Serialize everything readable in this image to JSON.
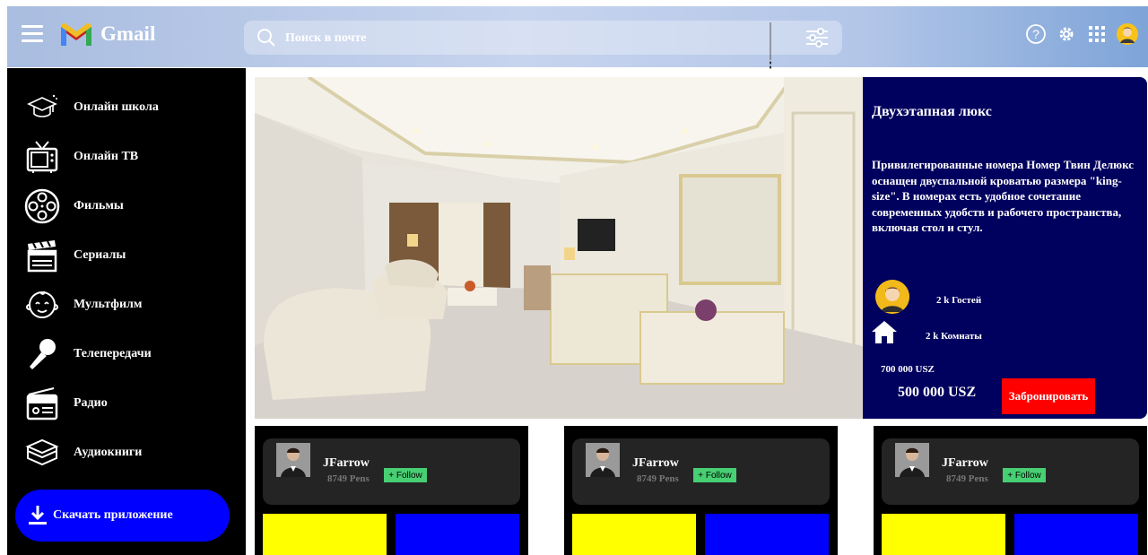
{
  "header": {
    "app_name": "Gmail",
    "search_placeholder": "Поиск в почте",
    "icons": [
      "menu-icon",
      "gmail-logo",
      "search-icon",
      "filter-options-icon",
      "help-icon",
      "settings-icon",
      "apps-grid-icon",
      "account-avatar"
    ]
  },
  "sidebar": {
    "items": [
      {
        "label": "Онлайн школа",
        "icon": "graduation-cap-icon"
      },
      {
        "label": "Онлайн ТВ",
        "icon": "tv-icon"
      },
      {
        "label": "Фильмы",
        "icon": "film-reel-icon"
      },
      {
        "label": "Сериалы",
        "icon": "clapperboard-icon"
      },
      {
        "label": "Мультфилм",
        "icon": "baby-face-icon"
      },
      {
        "label": "Телепередачи",
        "icon": "microphone-icon"
      },
      {
        "label": "Радио",
        "icon": "radio-icon"
      },
      {
        "label": "Аудиокниги",
        "icon": "books-icon"
      }
    ],
    "download_label": "Скачать приложение"
  },
  "room": {
    "title": "Двухэтапная люкс",
    "description": "Привилегированные номера Номер Твин Делюкс оснащен двуспальной кроватью размера \"king-size\". В номерах есть удобное сочетание современных удобств и рабочего пространства, включая стол и стул.",
    "guests": "2 k Гостей",
    "rooms": "2 k Комнаты",
    "old_price": "700 000 USZ",
    "new_price": "500 000 USZ",
    "book_label": "Забронировать"
  },
  "cards": [
    {
      "name": "JFarrow",
      "pens": "8749 Pens",
      "follow": "+ Follow"
    },
    {
      "name": "JFarrow",
      "pens": "8749 Pens",
      "follow": "+ Follow"
    },
    {
      "name": "JFarrow",
      "pens": "8749 Pens",
      "follow": "+ Follow"
    }
  ],
  "colors": {
    "sidebar_bg": "#000000",
    "download_button": "#0000ff",
    "info_panel": "#00005e",
    "book_button": "#ff0000",
    "follow_button": "#47cf73",
    "card_yellow": "#ffff00",
    "card_blue": "#0000ff"
  }
}
